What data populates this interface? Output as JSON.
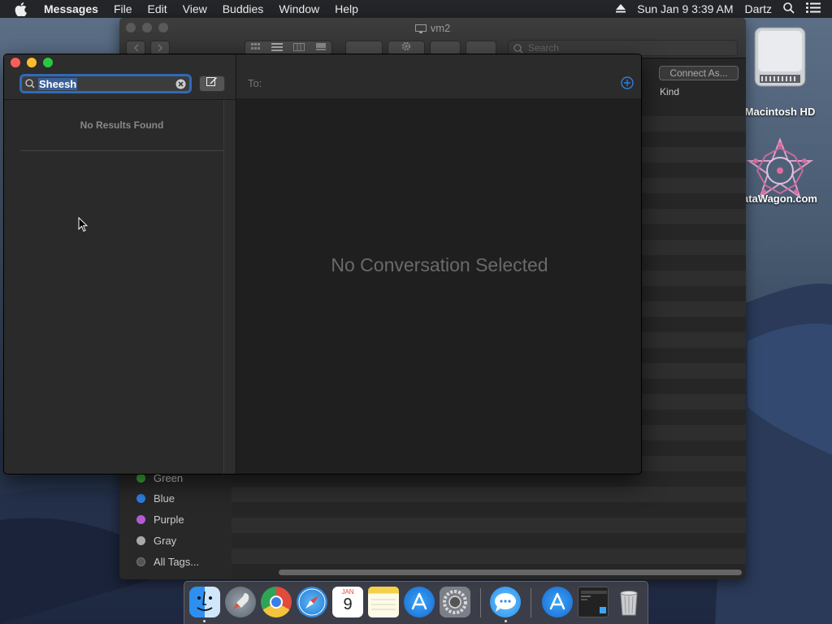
{
  "menubar": {
    "app_name": "Messages",
    "menus": [
      "File",
      "Edit",
      "View",
      "Buddies",
      "Window",
      "Help"
    ],
    "clock": "Sun Jan 9  3:39 AM",
    "user": "Dartz"
  },
  "finder": {
    "title": "vm2",
    "search_placeholder": "Search",
    "connect_label": "Connect As...",
    "kind_header": "Kind",
    "tags": [
      {
        "label": "Green",
        "color": "#3cae3c"
      },
      {
        "label": "Blue",
        "color": "#2f7de0"
      },
      {
        "label": "Purple",
        "color": "#b45ad6"
      },
      {
        "label": "Gray",
        "color": "#a8a8a8"
      },
      {
        "label": "All Tags...",
        "color": "#555555"
      }
    ]
  },
  "desktop": {
    "icons": [
      {
        "label": "Macintosh HD",
        "icon": "hard-drive-icon"
      },
      {
        "label": "ataWagon.com",
        "icon": "datawagon-logo-icon"
      }
    ]
  },
  "messages": {
    "search_value": "Sheesh",
    "no_results": "No Results Found",
    "to_label": "To:",
    "empty_state": "No Conversation Selected"
  },
  "dock": {
    "calendar_month": "JAN",
    "calendar_day": "9",
    "apps": [
      "finder-icon",
      "launchpad-icon",
      "chrome-icon",
      "safari-icon",
      "calendar-icon",
      "notes-icon",
      "app-store-icon",
      "system-preferences-icon",
      "messages-icon",
      "app-store-icon",
      "screenshot-icon",
      "trash-icon"
    ]
  },
  "colors": {
    "accent": "#2f6ab8",
    "close": "#fc5f57",
    "minimize": "#fdbc2e",
    "zoom": "#29c840"
  }
}
